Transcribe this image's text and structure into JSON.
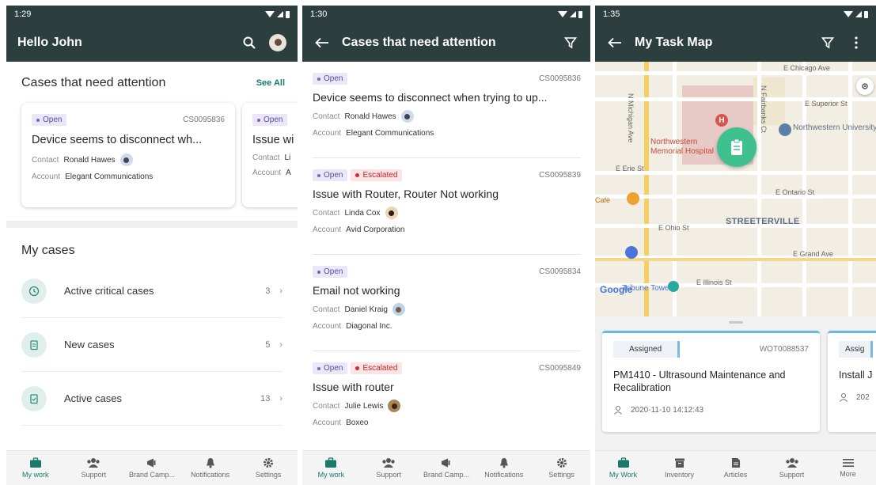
{
  "colors": {
    "appbar": "#2d3e3e",
    "accent": "#177a6b",
    "open_badge": "#ebe7f8",
    "escalated_badge": "#fbe4e5",
    "task_marker": "#3ec18f"
  },
  "screen1": {
    "time": "1:29",
    "title": "Hello John",
    "attention_title": "Cases that need attention",
    "see_all": "See All",
    "cards": [
      {
        "status": "Open",
        "id": "CS0095836",
        "title": "Device seems to disconnect wh...",
        "contact_label": "Contact",
        "contact": "Ronald Hawes",
        "account_label": "Account",
        "account": "Elegant Communications"
      },
      {
        "status": "Open",
        "title": "Issue wi",
        "contact_label": "Contact",
        "contact": "Li",
        "account_label": "Account",
        "account": "A"
      }
    ],
    "my_cases_title": "My cases",
    "my_cases": [
      {
        "label": "Active critical cases",
        "count": "3",
        "icon": "clock-icon"
      },
      {
        "label": "New cases",
        "count": "5",
        "icon": "clipboard-icon"
      },
      {
        "label": "Active cases",
        "count": "13",
        "icon": "clipboard-check-icon"
      }
    ],
    "nav": [
      "My work",
      "Support",
      "Brand Camp...",
      "Notifications",
      "Settings"
    ]
  },
  "screen2": {
    "time": "1:30",
    "title": "Cases that need attention",
    "cases": [
      {
        "status": "Open",
        "escalated": "",
        "id": "CS0095836",
        "title": "Device seems to disconnect when trying to up...",
        "contact_label": "Contact",
        "contact": "Ronald Hawes",
        "account_label": "Account",
        "account": "Elegant Communications"
      },
      {
        "status": "Open",
        "escalated": "Escalated",
        "id": "CS0095839",
        "title": "Issue with Router, Router Not working",
        "contact_label": "Contact",
        "contact": "Linda Cox",
        "account_label": "Account",
        "account": "Avid Corporation"
      },
      {
        "status": "Open",
        "escalated": "",
        "id": "CS0095834",
        "title": "Email not working",
        "contact_label": "Contact",
        "contact": "Daniel Kraig",
        "account_label": "Account",
        "account": "Diagonal Inc."
      },
      {
        "status": "Open",
        "escalated": "Escalated",
        "id": "CS0095849",
        "title": "Issue with router",
        "contact_label": "Contact",
        "contact": "Julie Lewis",
        "account_label": "Account",
        "account": "Boxeo"
      }
    ],
    "nav": [
      "My work",
      "Support",
      "Brand Camp...",
      "Notifications",
      "Settings"
    ]
  },
  "screen3": {
    "time": "1:35",
    "title": "My Task Map",
    "map_labels": {
      "chicago": "E Chicago Ave",
      "superior": "E Superior St",
      "northwestern": "Northwestern University",
      "hospital": "Northwestern Memorial Hospital",
      "erie": "E Erie St",
      "cafe": "Cafe",
      "ontario": "E Ontario St",
      "ohio": "E Ohio St",
      "streeterville": "STREETERVILLE",
      "grand": "E Grand Ave",
      "illinois": "E Illinois St",
      "tower": "Tribune Tower",
      "michigan": "N Michigan Ave",
      "fairbanks": "N Fairbanks Ct",
      "google": "Google"
    },
    "tasks": [
      {
        "status": "Assigned",
        "id": "WOT0088537",
        "title": "PM1410 - Ultrasound Maintenance and Recalibration",
        "date": "2020-11-10 14:12:43"
      },
      {
        "status": "Assig",
        "title": "Install J",
        "date": "202"
      }
    ],
    "nav": [
      "My Work",
      "Inventory",
      "Articles",
      "Support",
      "More"
    ]
  }
}
